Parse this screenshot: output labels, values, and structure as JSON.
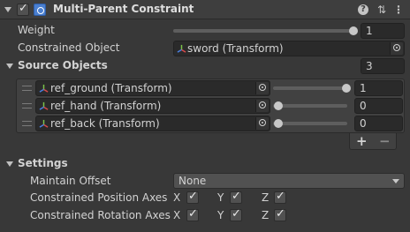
{
  "component": {
    "title": "Multi-Parent Constraint",
    "enabled": true
  },
  "weight": {
    "label": "Weight",
    "value": "1",
    "slider_fraction": 1.0
  },
  "constrained_object": {
    "label": "Constrained Object",
    "value": "sword (Transform)"
  },
  "source_objects": {
    "label": "Source Objects",
    "count": "3",
    "items": [
      {
        "object": "ref_ground (Transform)",
        "weight": "1",
        "slider_fraction": 1.0
      },
      {
        "object": "ref_hand (Transform)",
        "weight": "0",
        "slider_fraction": 0.0
      },
      {
        "object": "ref_back (Transform)",
        "weight": "0",
        "slider_fraction": 0.0
      }
    ],
    "add_label": "+",
    "remove_label": "−"
  },
  "settings": {
    "label": "Settings",
    "maintain_offset": {
      "label": "Maintain Offset",
      "value": "None"
    },
    "position_axes": {
      "label": "Constrained Position Axes",
      "x": "X",
      "y": "Y",
      "z": "Z",
      "x_checked": true,
      "y_checked": true,
      "z_checked": true
    },
    "rotation_axes": {
      "label": "Constrained Rotation Axes",
      "x": "X",
      "y": "Y",
      "z": "Z",
      "x_checked": true,
      "y_checked": true,
      "z_checked": true
    }
  },
  "icons": {
    "help": "help-icon",
    "presets": "sliders-icon",
    "menu": "kebab-menu-icon",
    "object": "transform-axes-icon",
    "target": "object-picker-icon"
  },
  "colors": {
    "background": "#383838",
    "component_icon": "#4a7fd0"
  }
}
